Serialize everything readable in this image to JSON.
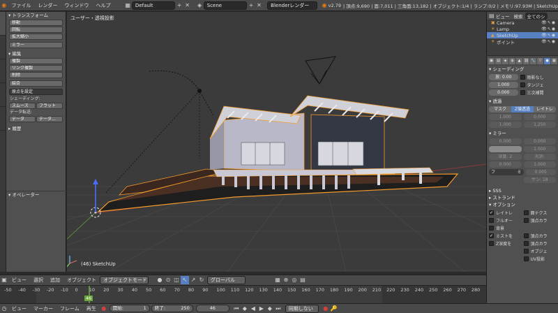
{
  "menu": {
    "items": [
      "ファイル",
      "レンダー",
      "ウィンドウ",
      "ヘルプ"
    ],
    "screen_layout": "Default",
    "scene": "Scene",
    "render_engine": "Blenderレンダー",
    "version": "v2.79",
    "stats": "| 頂点:9,690 | 面:7,011 | 三角面:13,182 | オブジェクト:1/4 | ランプ:0/2 | メモリ:97.93M | SketchUp"
  },
  "toolshelf": {
    "transform_header": "▾ トランスフォーム",
    "transform_buttons": [
      "移動",
      "回転",
      "拡大縮小",
      "ミラー"
    ],
    "edit_header": "▾ 編集",
    "edit_buttons": [
      "複製",
      "リンク複製",
      "削除",
      "結合"
    ],
    "origin_select": "原点を設定",
    "shading_label": "シェーディング:",
    "shading_buttons": [
      "スムーズ",
      "フラット"
    ],
    "data_transfer_label": "データ転送:",
    "data_transfer_buttons": [
      "データ",
      "データ..."
    ],
    "history_header": "▸ 履歴",
    "operator_header": "▾ オペレーター"
  },
  "viewport": {
    "title": "ユーザー・透視投影",
    "object_label": "(46) SketchUp"
  },
  "viewport_header": {
    "items": [
      "ビュー",
      "選択",
      "追加",
      "オブジェクト"
    ],
    "mode": "オブジェクトモード",
    "pivot": "グローバル"
  },
  "timeline": {
    "ticks": [
      "-50",
      "-40",
      "-30",
      "-20",
      "-10",
      "0",
      "10",
      "20",
      "30",
      "40",
      "50",
      "60",
      "70",
      "80",
      "90",
      "100",
      "110",
      "120",
      "130",
      "140",
      "150",
      "160",
      "170",
      "180",
      "190",
      "200",
      "210",
      "220",
      "230",
      "240",
      "250",
      "260",
      "270",
      "280"
    ],
    "current_frame_marker": 46
  },
  "timeline_header": {
    "items": [
      "ビュー",
      "マーカー",
      "フレーム",
      "再生"
    ],
    "start_label": "開始:",
    "start_value": "1",
    "end_label": "終了:",
    "end_value": "250",
    "current_frame": "46",
    "sync": "同期しない"
  },
  "outliner": {
    "tabs": [
      "ビュー",
      "検索",
      "全てのシ"
    ],
    "items": [
      {
        "name": "Camera",
        "selected": false
      },
      {
        "name": "Lamp",
        "selected": false
      },
      {
        "name": "SketchUp",
        "selected": true
      },
      {
        "name": "ポイント",
        "selected": false
      }
    ]
  },
  "properties": {
    "shading": {
      "header": "▾ シェーディング",
      "emit_label": "放:",
      "emit_value": "0.00",
      "no_shadow": "陰影なし",
      "ambient_value": "1.000",
      "tangent": "タンジェ",
      "translucency_value": "0.000",
      "cubic": "三次補間"
    },
    "transparency": {
      "header": "▾ 透過",
      "modes": [
        "マスク",
        "Z値透過",
        "レイトレ"
      ],
      "val1": "1.000",
      "val2": "0.000",
      "val3": "1.000",
      "val4": "1.250"
    },
    "mirror": {
      "header": "▾ ミラー",
      "val1": "0.000",
      "val2": "0.000",
      "depth_label": "深度:",
      "depth_value": "2",
      "gloss_label": "光沢:",
      "gloss_value": "1.000",
      "val3": "0.000",
      "val4": "0.005",
      "fade_label": "フ",
      "fade_value": "ミ",
      "samples_label": "サン:",
      "samples_value": "18",
      "val5": "1.000"
    },
    "sss_header": "▸ SSS",
    "strand_header": "▸ ストランド",
    "options": {
      "header": "▾ オプション",
      "rows": [
        {
          "left": "レイトレ",
          "left_checked": true,
          "right": "面テクス",
          "right_checked": false
        },
        {
          "left": "フルオー",
          "left_checked": false,
          "right": "頂点カラ",
          "right_checked": false
        },
        {
          "left": "背景",
          "left_checked": false,
          "right": "",
          "right_checked": false
        },
        {
          "left": "ミストを",
          "left_checked": true,
          "right": "頂点カラ",
          "right_checked": false
        },
        {
          "left": "Z深度を",
          "left_checked": false,
          "right": "頂点カラ",
          "right_checked": false
        },
        {
          "left": "",
          "left_checked": false,
          "right": "オブジェ",
          "right_checked": false
        },
        {
          "left": "",
          "left_checked": false,
          "right": "UV投影",
          "right_checked": false
        }
      ]
    }
  }
}
